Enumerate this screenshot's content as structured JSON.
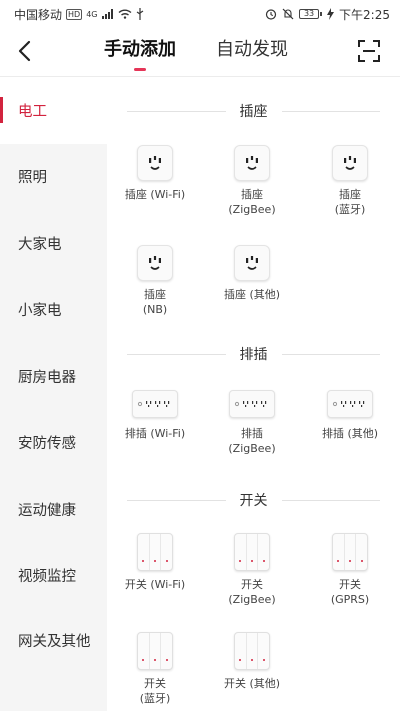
{
  "status_bar": {
    "carrier": "中国移动",
    "hd": "HD",
    "signal": "4G",
    "battery": "33",
    "time": "下午2:25"
  },
  "nav": {
    "tabs": [
      "手动添加",
      "自动发现"
    ],
    "accent_color": "#e53558"
  },
  "sidebar": {
    "items": [
      "电工",
      "照明",
      "大家电",
      "小家电",
      "厨房电器",
      "安防传感",
      "运动健康",
      "视频监控",
      "网关及其他"
    ],
    "active_index": 0,
    "active_color": "#d2233e"
  },
  "sections": [
    {
      "title": "插座",
      "devices": [
        "插座 (Wi-Fi)",
        "插座\n(ZigBee)",
        "插座\n(蓝牙)",
        "插座\n(NB)",
        "插座 (其他)"
      ]
    },
    {
      "title": "排插",
      "devices": [
        "排插 (Wi-Fi)",
        "排插\n(ZigBee)",
        "排插 (其他)"
      ]
    },
    {
      "title": "开关",
      "devices": [
        "开关 (Wi-Fi)",
        "开关\n(ZigBee)",
        "开关\n(GPRS)",
        "开关\n(蓝牙)",
        "开关 (其他)"
      ]
    }
  ]
}
